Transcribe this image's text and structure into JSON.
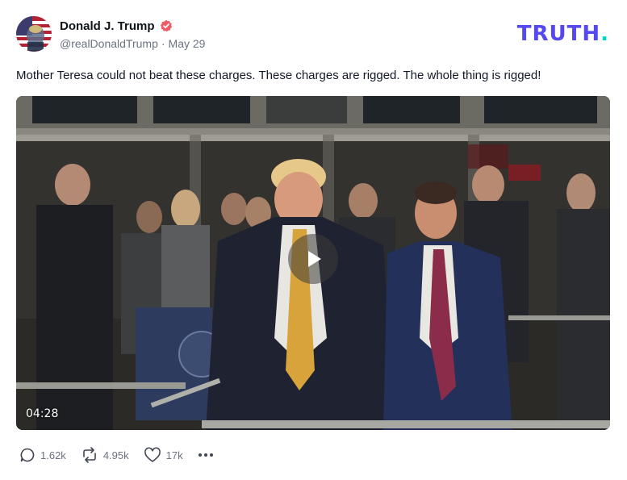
{
  "author": {
    "display_name": "Donald J. Trump",
    "handle": "@realDonaldTrump",
    "separator": "·",
    "date": "May 29",
    "verified": true,
    "avatar_icon": "american-flag-portrait-avatar"
  },
  "brand": {
    "logo_text": "TRUTH",
    "logo_dot": ".",
    "logo_color": "#5448ee",
    "dot_color": "#00d9c9"
  },
  "post": {
    "text": "Mother Teresa could not beat these charges. These charges are rigged. The whole thing is rigged!"
  },
  "video": {
    "duration": "04:28",
    "play_icon": "play-icon"
  },
  "actions": {
    "replies": "1.62k",
    "retruths": "4.95k",
    "likes": "17k",
    "more_icon": "ellipsis-icon"
  },
  "colors": {
    "verified_badge": "#f05a67",
    "muted_text": "#6b7280",
    "text": "#0f1419"
  }
}
